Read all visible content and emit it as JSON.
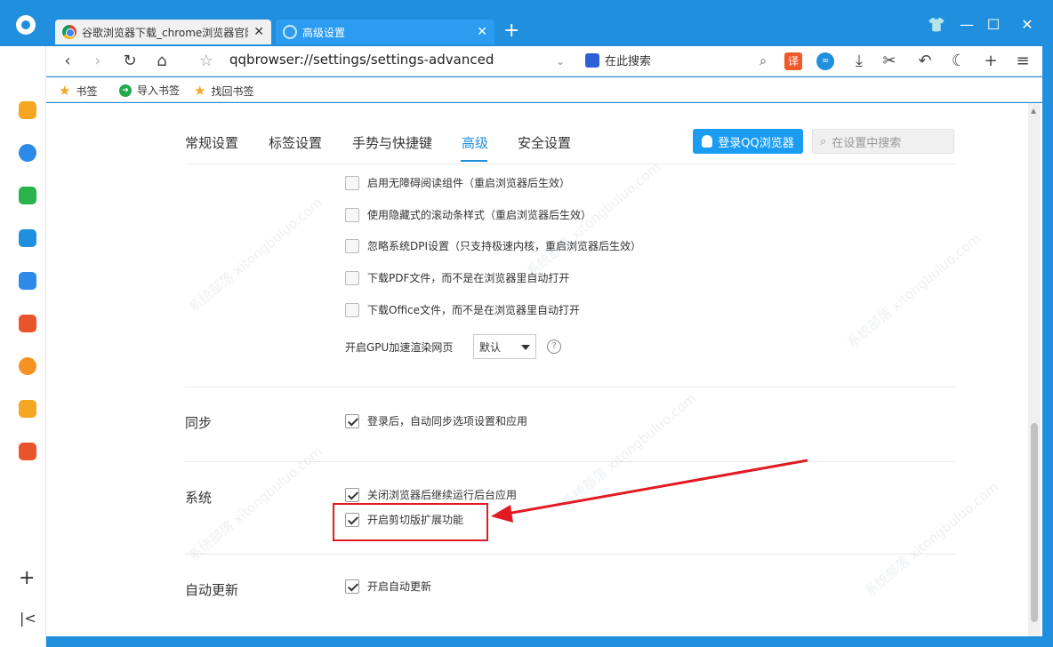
{
  "window": {
    "tabs": [
      {
        "label": "谷歌浏览器下载_chrome浏览器官网",
        "active": false
      },
      {
        "label": "高级设置",
        "active": true
      }
    ],
    "controls": {
      "skin": "👕",
      "minimize": "—",
      "maximize": "☐",
      "close": "✕"
    }
  },
  "toolbar": {
    "address": "qqbrowser://settings/settings-advanced",
    "search_engine_label": "在此搜索",
    "translate_label": "译"
  },
  "bookmarks": {
    "items": [
      "书签",
      "导入书签",
      "找回书签"
    ]
  },
  "settings": {
    "nav": [
      "常规设置",
      "标签设置",
      "手势与快捷键",
      "高级",
      "安全设置"
    ],
    "login_button": "登录QQ浏览器",
    "search_placeholder": "在设置中搜索",
    "advanced_options": [
      {
        "label": "启用无障碍阅读组件（重启浏览器后生效）",
        "checked": false
      },
      {
        "label": "使用隐藏式的滚动条样式（重启浏览器后生效）",
        "checked": false
      },
      {
        "label": "忽略系统DPI设置（只支持极速内核，重启浏览器后生效）",
        "checked": false
      },
      {
        "label": "下载PDF文件，而不是在浏览器里自动打开",
        "checked": false
      },
      {
        "label": "下载Office文件，而不是在浏览器里自动打开",
        "checked": false
      }
    ],
    "gpu": {
      "label": "开启GPU加速渲染网页",
      "value": "默认",
      "help": "?"
    },
    "sync": {
      "title": "同步",
      "option": "登录后，自动同步选项设置和应用",
      "checked": true
    },
    "system": {
      "title": "系统",
      "options": [
        {
          "label": "关闭浏览器后继续运行后台应用",
          "checked": true
        },
        {
          "label": "开启剪切版扩展功能",
          "checked": true
        }
      ]
    },
    "auto_update": {
      "title": "自动更新",
      "option": "开启自动更新",
      "checked": true
    }
  },
  "watermark": "系统部落 xitongbuluo.com",
  "colors": {
    "accent": "#1f8fde",
    "highlight": "#e21b23"
  }
}
